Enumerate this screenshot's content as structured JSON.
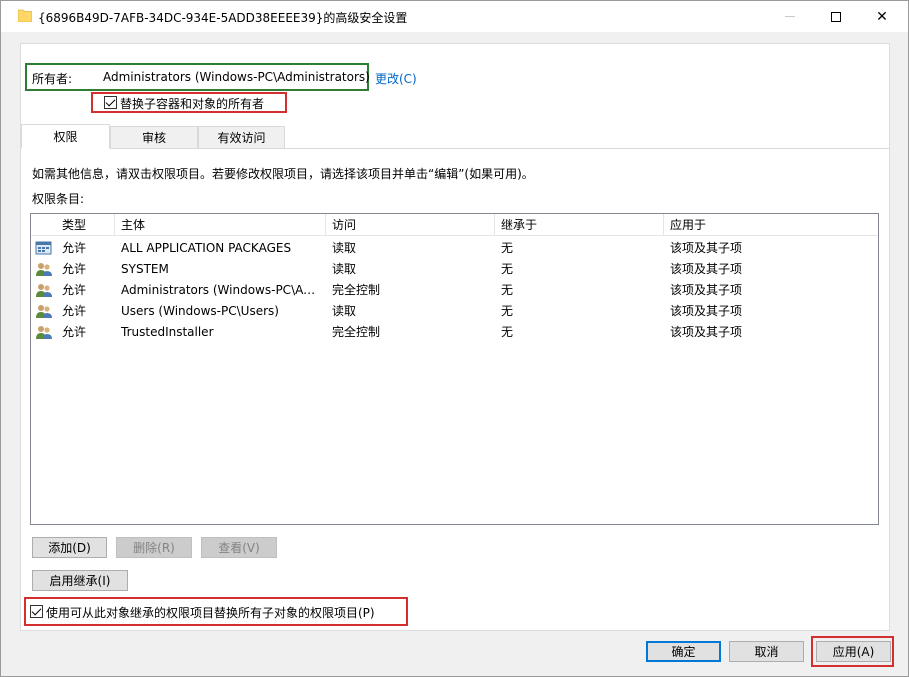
{
  "window": {
    "title": "{6896B49D-7AFB-34DC-934E-5ADD38EEEE39}的高级安全设置",
    "minimize_icon": "minimize-icon",
    "maximize_icon": "maximize-icon",
    "close_glyph": "✕"
  },
  "owner": {
    "label": "所有者:",
    "value": "Administrators (Windows-PC\\Administrators)",
    "change_link": "更改(C)"
  },
  "replace_owner": {
    "label": "替换子容器和对象的所有者",
    "checked": true
  },
  "tabs": [
    {
      "label": "权限",
      "active": true
    },
    {
      "label": "审核",
      "active": false
    },
    {
      "label": "有效访问",
      "active": false
    }
  ],
  "info_text": "如需其他信息，请双击权限项目。若要修改权限项目，请选择该项目并单击“编辑”(如果可用)。",
  "entries_label": "权限条目:",
  "table": {
    "headers": [
      "类型",
      "主体",
      "访问",
      "继承于",
      "应用于"
    ],
    "rows": [
      {
        "icon": "app-packages-icon",
        "type": "允许",
        "principal": "ALL APPLICATION PACKAGES",
        "access": "读取",
        "inherited": "无",
        "applies": "该项及其子项"
      },
      {
        "icon": "users-icon",
        "type": "允许",
        "principal": "SYSTEM",
        "access": "读取",
        "inherited": "无",
        "applies": "该项及其子项"
      },
      {
        "icon": "users-icon",
        "type": "允许",
        "principal": "Administrators (Windows-PC\\Ad...",
        "access": "完全控制",
        "inherited": "无",
        "applies": "该项及其子项"
      },
      {
        "icon": "users-icon",
        "type": "允许",
        "principal": "Users (Windows-PC\\Users)",
        "access": "读取",
        "inherited": "无",
        "applies": "该项及其子项"
      },
      {
        "icon": "users-icon",
        "type": "允许",
        "principal": "TrustedInstaller",
        "access": "完全控制",
        "inherited": "无",
        "applies": "该项及其子项"
      }
    ]
  },
  "buttons": {
    "add": "添加(D)",
    "remove": "删除(R)",
    "view": "查看(V)",
    "enable_inheritance": "启用继承(I)",
    "ok": "确定",
    "cancel": "取消",
    "apply": "应用(A)"
  },
  "replace_child": {
    "label": "使用可从此对象继承的权限项目替换所有子对象的权限项目(P)",
    "checked": true
  },
  "colors": {
    "owner_highlight": "#2e7d32",
    "annotation_highlight": "#d32f2f",
    "link": "#0066cc"
  }
}
